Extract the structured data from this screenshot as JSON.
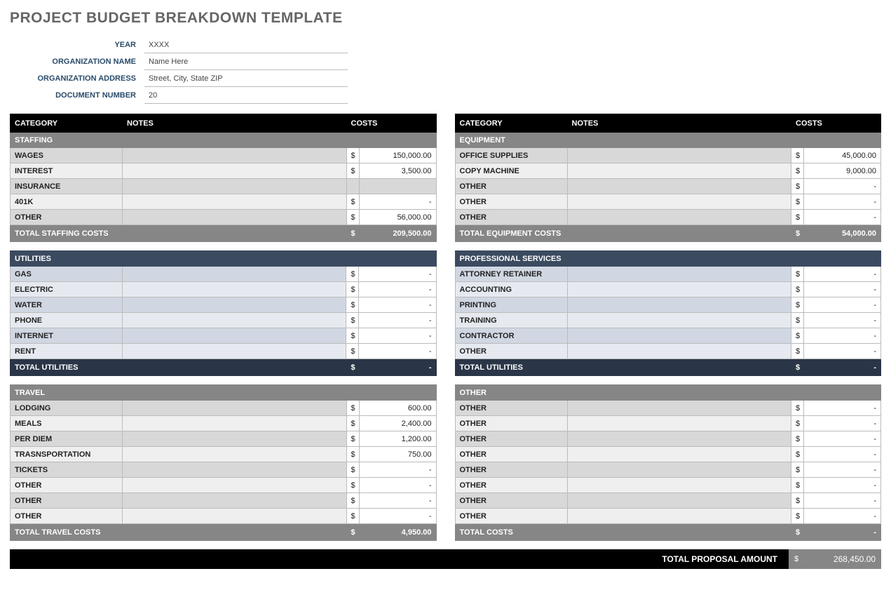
{
  "title": "PROJECT BUDGET BREAKDOWN TEMPLATE",
  "meta": {
    "year_label": "YEAR",
    "year_value": "XXXX",
    "org_name_label": "ORGANIZATION NAME",
    "org_name_value": "Name Here",
    "org_addr_label": "ORGANIZATION ADDRESS",
    "org_addr_value": "Street, City, State ZIP",
    "doc_num_label": "DOCUMENT NUMBER",
    "doc_num_value": "20"
  },
  "headers": {
    "category": "CATEGORY",
    "notes": "NOTES",
    "costs": "COSTS"
  },
  "left": {
    "staffing": {
      "title": "STAFFING",
      "rows": [
        {
          "label": "WAGES",
          "cost": "150,000.00"
        },
        {
          "label": "INTEREST",
          "cost": "3,500.00"
        },
        {
          "label": "INSURANCE",
          "cost": ""
        },
        {
          "label": "401K",
          "cost": "-"
        },
        {
          "label": "OTHER",
          "cost": "56,000.00"
        }
      ],
      "total_label": "TOTAL STAFFING COSTS",
      "total": "209,500.00"
    },
    "utilities": {
      "title": "UTILITIES",
      "rows": [
        {
          "label": "GAS",
          "cost": "-"
        },
        {
          "label": "ELECTRIC",
          "cost": "-"
        },
        {
          "label": "WATER",
          "cost": "-"
        },
        {
          "label": "PHONE",
          "cost": "-"
        },
        {
          "label": "INTERNET",
          "cost": "-"
        },
        {
          "label": "RENT",
          "cost": "-"
        }
      ],
      "total_label": "TOTAL UTILITIES",
      "total": "-"
    },
    "travel": {
      "title": "TRAVEL",
      "rows": [
        {
          "label": "LODGING",
          "cost": "600.00"
        },
        {
          "label": "MEALS",
          "cost": "2,400.00"
        },
        {
          "label": "PER DIEM",
          "cost": "1,200.00"
        },
        {
          "label": "TRASNSPORTATION",
          "cost": "750.00"
        },
        {
          "label": "TICKETS",
          "cost": "-"
        },
        {
          "label": "OTHER",
          "cost": "-"
        },
        {
          "label": "OTHER",
          "cost": "-"
        },
        {
          "label": "OTHER",
          "cost": "-"
        }
      ],
      "total_label": "TOTAL TRAVEL COSTS",
      "total": "4,950.00"
    }
  },
  "right": {
    "equipment": {
      "title": "EQUIPMENT",
      "rows": [
        {
          "label": "OFFICE SUPPLIES",
          "cost": "45,000.00"
        },
        {
          "label": "COPY MACHINE",
          "cost": "9,000.00"
        },
        {
          "label": "OTHER",
          "cost": "-"
        },
        {
          "label": "OTHER",
          "cost": "-"
        },
        {
          "label": "OTHER",
          "cost": "-"
        }
      ],
      "total_label": "TOTAL EQUIPMENT COSTS",
      "total": "54,000.00"
    },
    "professional": {
      "title": "PROFESSIONAL SERVICES",
      "rows": [
        {
          "label": "ATTORNEY RETAINER",
          "cost": "-"
        },
        {
          "label": "ACCOUNTING",
          "cost": "-"
        },
        {
          "label": "PRINTING",
          "cost": "-"
        },
        {
          "label": "TRAINING",
          "cost": "-"
        },
        {
          "label": "CONTRACTOR",
          "cost": "-"
        },
        {
          "label": "OTHER",
          "cost": "-"
        }
      ],
      "total_label": "TOTAL UTILITIES",
      "total": "-"
    },
    "other": {
      "title": "OTHER",
      "rows": [
        {
          "label": "OTHER",
          "cost": "-"
        },
        {
          "label": "OTHER",
          "cost": "-"
        },
        {
          "label": "OTHER",
          "cost": "-"
        },
        {
          "label": "OTHER",
          "cost": "-"
        },
        {
          "label": "OTHER",
          "cost": "-"
        },
        {
          "label": "OTHER",
          "cost": "-"
        },
        {
          "label": "OTHER",
          "cost": "-"
        },
        {
          "label": "OTHER",
          "cost": "-"
        }
      ],
      "total_label": "TOTAL COSTS",
      "total": "-"
    }
  },
  "footer": {
    "label": "TOTAL PROPOSAL AMOUNT",
    "amount": "268,450.00"
  }
}
